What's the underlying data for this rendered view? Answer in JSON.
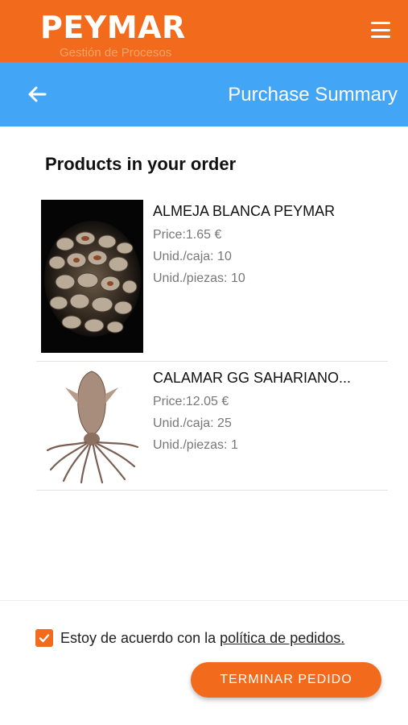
{
  "colors": {
    "brand": "#f26a1b",
    "header_blue": "#42a5f5",
    "text_gray": "#777777"
  },
  "brand": {
    "name": "PEYMAR",
    "tagline": "Gestión de Procesos"
  },
  "header": {
    "title": "Purchase Summary",
    "back_icon": "arrow-left-icon",
    "menu_icon": "hamburger-menu-icon"
  },
  "section": {
    "heading": "Products in your order"
  },
  "products": [
    {
      "name": "ALMEJA BLANCA PEYMAR",
      "price_label": "Price:",
      "price": "1.65 €",
      "box_label": "Unid./caja:",
      "box": "10",
      "pieces_label": "Unid./piezas:",
      "pieces": "10",
      "image": "clams-photo"
    },
    {
      "name": "CALAMAR GG SAHARIANO...",
      "price_label": "Price:",
      "price": "12.05 €",
      "box_label": "Unid./caja:",
      "box": "25",
      "pieces_label": "Unid./piezas:",
      "pieces": "1",
      "image": "squid-photo"
    }
  ],
  "footer": {
    "agree_text": "Estoy de acuerdo con la",
    "agree_link": "política de pedidos.",
    "checkbox_checked": true,
    "submit_label": "TERMINAR PEDIDO"
  }
}
